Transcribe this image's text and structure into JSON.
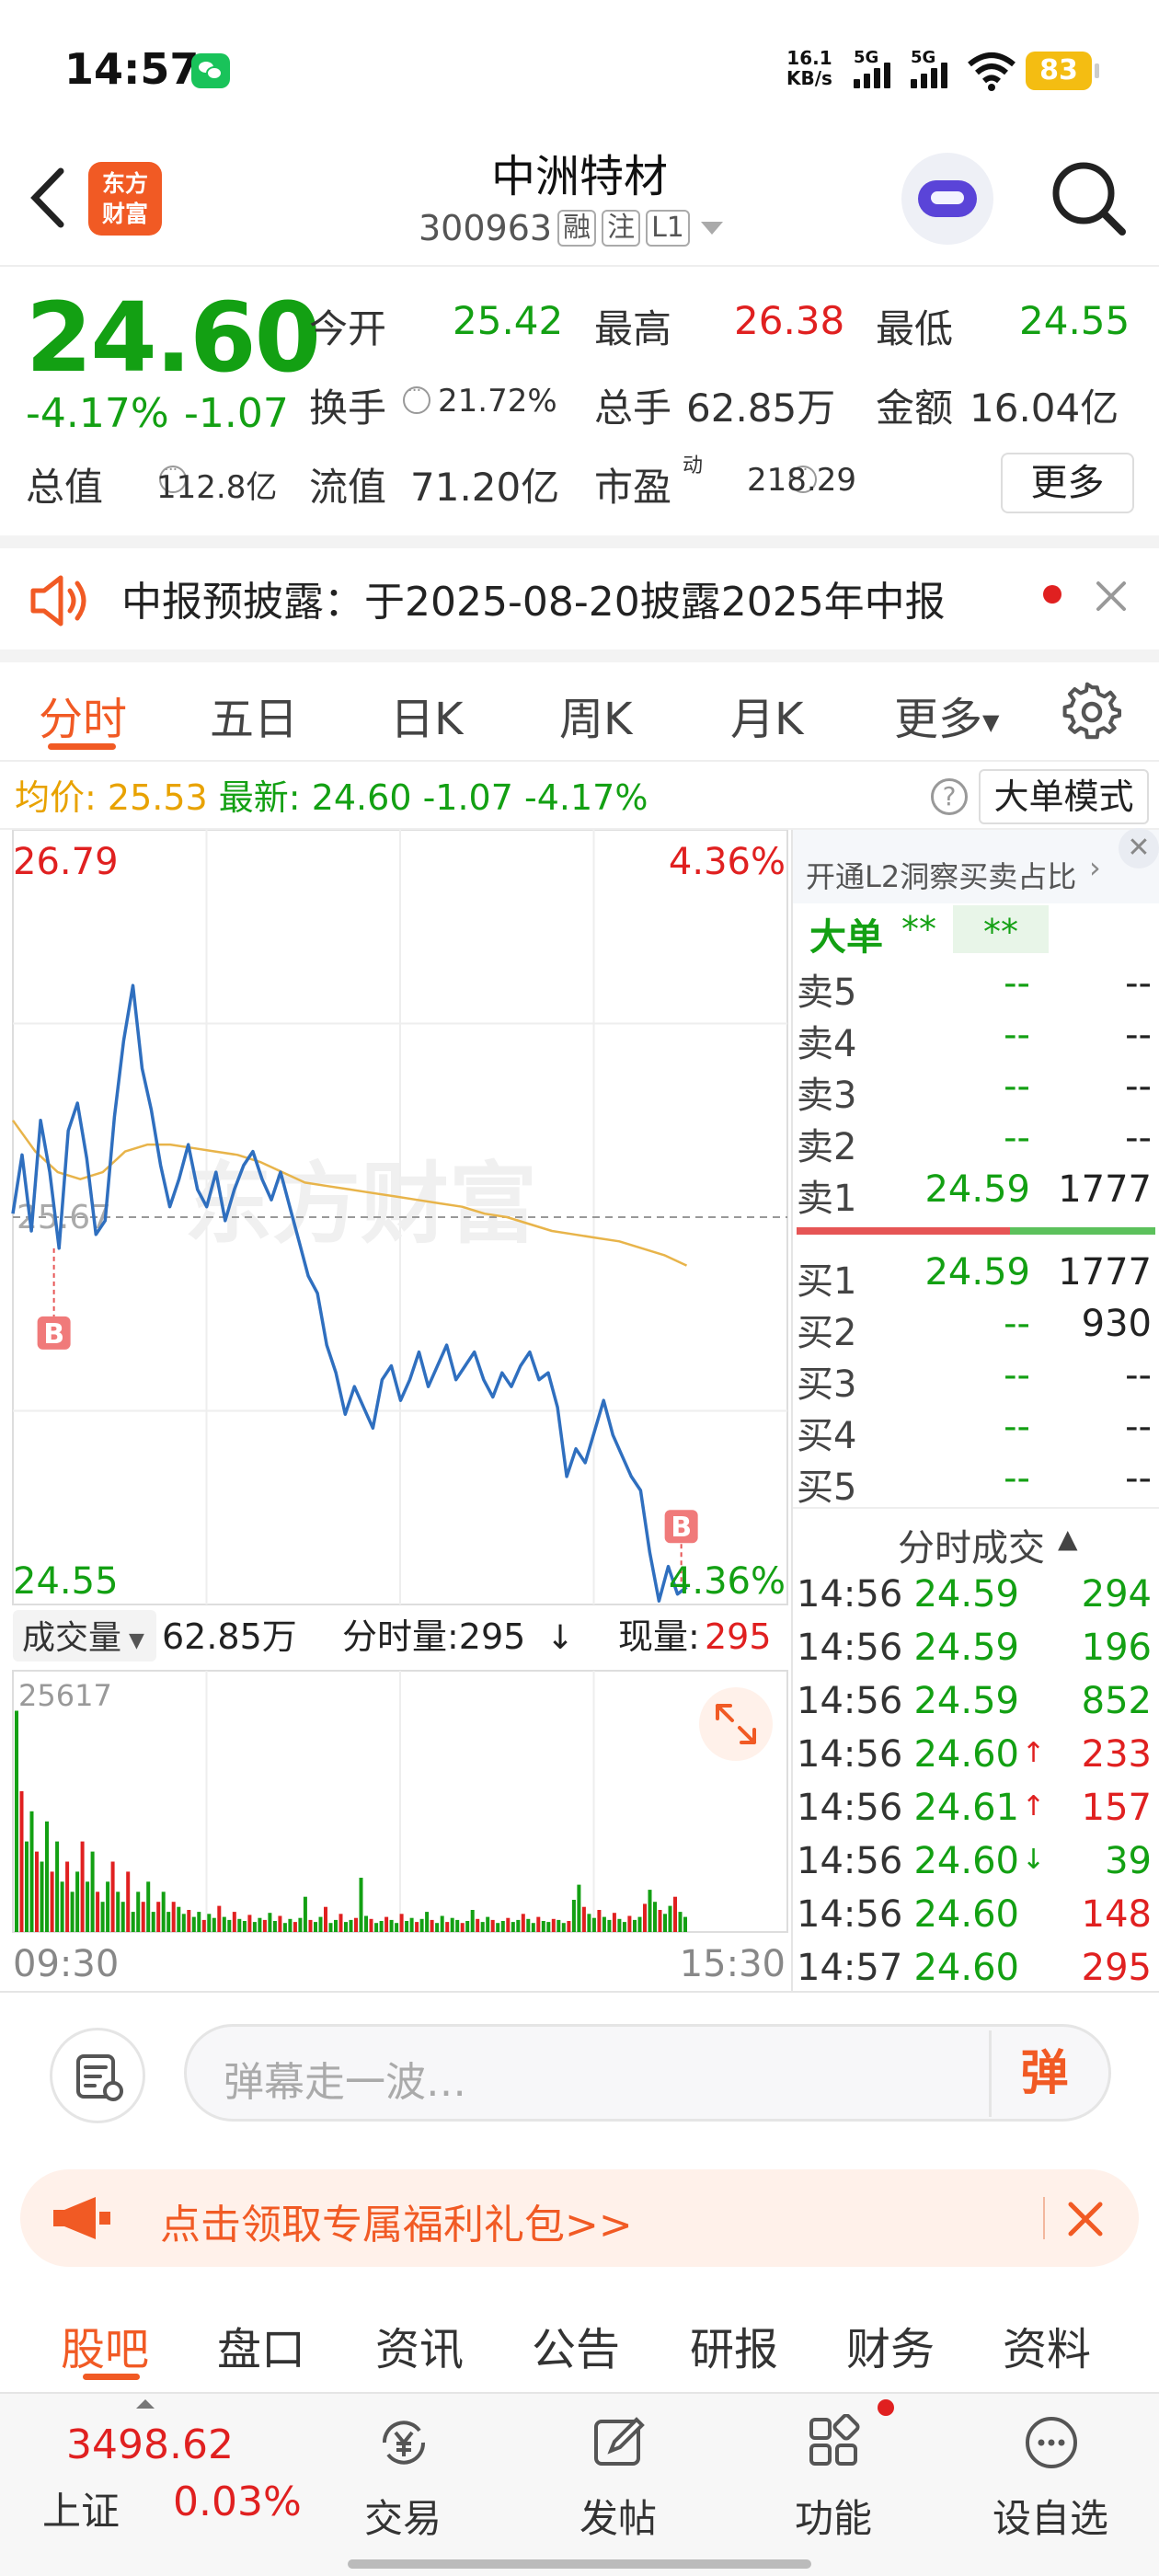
{
  "status_bar": {
    "time": "14:57",
    "net_speed_value": "16.1",
    "net_speed_unit": "KB/s",
    "signal1": "5G",
    "signal2": "5G",
    "battery": "83"
  },
  "header": {
    "logo_line1": "东方",
    "logo_line2": "财富",
    "stock_name": "中洲特材",
    "stock_code": "300963",
    "tags": [
      "融",
      "注",
      "L1"
    ]
  },
  "quote": {
    "price": "24.60",
    "change_pct": "-4.17%",
    "change": "-1.07",
    "open_label": "今开",
    "open": "25.42",
    "high_label": "最高",
    "high": "26.38",
    "low_label": "最低",
    "low": "24.55",
    "turnover_label": "换手",
    "turnover": "21.72%",
    "volume_label": "总手",
    "volume": "62.85万",
    "amount_label": "金额",
    "amount": "16.04亿",
    "mktcap_label": "总值",
    "mktcap": "112.8亿",
    "float_label": "流值",
    "float": "71.20亿",
    "pe_label": "市盈",
    "pe_sup": "动",
    "pe": "218.29",
    "more_button": "更多"
  },
  "notice": {
    "text": "中报预披露：于2025-08-20披露2025年中报"
  },
  "chart_tabs": {
    "items": [
      "分时",
      "五日",
      "日K",
      "周K",
      "月K",
      "更多"
    ],
    "active": "分时"
  },
  "info_line": {
    "avg_label": "均价:",
    "avg": "25.53",
    "latest_label": "最新:",
    "latest": "24.60",
    "change": "-1.07",
    "change_pct": "-4.17%",
    "help": "?",
    "mode_button": "大单模式"
  },
  "chart_data": {
    "type": "line",
    "title": "分时",
    "y_top": "26.79",
    "y_top_pct": "4.36%",
    "y_bottom": "24.55",
    "y_bottom_pct": "4.36%",
    "y_mid": "25.67",
    "watermark": "东方财富",
    "ylim": [
      24.55,
      26.79
    ],
    "marker_label": "B",
    "series": [
      {
        "values": [
          25.68,
          25.85,
          25.63,
          25.95,
          25.8,
          25.58,
          25.92,
          26.0,
          25.84,
          25.62,
          25.66,
          25.96,
          26.18,
          26.34,
          26.1,
          25.98,
          25.82,
          25.7,
          25.78,
          25.88,
          25.75,
          25.7,
          25.8,
          25.66,
          25.75,
          25.82,
          25.86,
          25.78,
          25.72,
          25.8,
          25.7,
          25.6,
          25.5,
          25.45,
          25.3,
          25.22,
          25.1,
          25.18,
          25.12,
          25.06,
          25.2,
          25.24,
          25.14,
          25.2,
          25.28,
          25.18,
          25.24,
          25.3,
          25.2,
          25.24,
          25.28,
          25.2,
          25.15,
          25.22,
          25.18,
          25.24,
          25.28,
          25.2,
          25.22,
          25.12,
          24.92,
          25.0,
          24.96,
          25.05,
          25.14,
          25.04,
          24.98,
          24.92,
          24.88,
          24.7,
          24.56,
          24.66,
          24.58,
          24.6
        ]
      },
      {
        "values": [
          25.95,
          25.86,
          25.8,
          25.78,
          25.8,
          25.86,
          25.88,
          25.88,
          25.87,
          25.86,
          25.85,
          25.83,
          25.8,
          25.77,
          25.76,
          25.75,
          25.74,
          25.73,
          25.72,
          25.71,
          25.7,
          25.68,
          25.67,
          25.65,
          25.63,
          25.62,
          25.61,
          25.6,
          25.58,
          25.56,
          25.53
        ]
      }
    ],
    "x_start": "09:30",
    "x_end": "15:30",
    "volume_label": "成交量",
    "volume_total": "62.85万",
    "minute_vol_label": "分时量:295",
    "current_vol_label": "现量:",
    "current_vol": "295",
    "volume_max": "25617",
    "volume_bars": [
      22000,
      14000,
      9000,
      12000,
      8000,
      7000,
      11000,
      6000,
      9000,
      5000,
      7000,
      4000,
      6000,
      9000,
      5000,
      8000,
      4000,
      3000,
      5000,
      7000,
      4000,
      3000,
      6000,
      2000,
      4000,
      3000,
      5000,
      2000,
      3000,
      4000,
      2000,
      3000,
      2500,
      1800,
      2200,
      1500,
      2000,
      1200,
      1800,
      1400,
      2600,
      1500,
      1200,
      2000,
      1300,
      1100,
      1700,
      1000,
      1400,
      1200,
      1900,
      1100,
      1600,
      900,
      1300,
      1000,
      1400,
      3500,
      1200,
      1000,
      1500,
      2500,
      900,
      1200,
      1800,
      1000,
      1200,
      1400,
      5400,
      1600,
      1300,
      900,
      1100,
      1500,
      1200,
      900,
      1800,
      1100,
      1400,
      1000,
      1300,
      2000,
      1200,
      900,
      1600,
      1000,
      1400,
      1200,
      900,
      1100,
      2200,
      1300,
      1000,
      1500,
      1200,
      900,
      1100,
      1400,
      1000,
      1200,
      1800,
      1300,
      900,
      1500,
      1100,
      1000,
      1300,
      1200,
      900,
      1100,
      3200,
      4700,
      2500,
      1800,
      1400,
      2200,
      1500,
      1200,
      1900,
      1300,
      1000,
      1600,
      1200,
      1500,
      2800,
      4200,
      3000,
      2200,
      1800,
      2600,
      3500,
      2000,
      1500
    ]
  },
  "right_panel": {
    "promo": "开通L2洞察买卖占比",
    "big_order_label": "大单",
    "big_order_v1": "**",
    "big_order_v2": "**",
    "asks": [
      {
        "label": "卖5",
        "price": "--",
        "vol": "--"
      },
      {
        "label": "卖4",
        "price": "--",
        "vol": "--"
      },
      {
        "label": "卖3",
        "price": "--",
        "vol": "--"
      },
      {
        "label": "卖2",
        "price": "--",
        "vol": "--"
      },
      {
        "label": "卖1",
        "price": "24.59",
        "vol": "1777"
      }
    ],
    "bids": [
      {
        "label": "买1",
        "price": "24.59",
        "vol": "1777"
      },
      {
        "label": "买2",
        "price": "--",
        "vol": "930"
      },
      {
        "label": "买3",
        "price": "--",
        "vol": "--"
      },
      {
        "label": "买4",
        "price": "--",
        "vol": "--"
      },
      {
        "label": "买5",
        "price": "--",
        "vol": "--"
      }
    ],
    "ticks_title": "分时成交",
    "ticks": [
      {
        "time": "14:56",
        "price": "24.59",
        "vol": "294",
        "arrow": "",
        "color": "green"
      },
      {
        "time": "14:56",
        "price": "24.59",
        "vol": "196",
        "arrow": "",
        "color": "green"
      },
      {
        "time": "14:56",
        "price": "24.59",
        "vol": "852",
        "arrow": "",
        "color": "green"
      },
      {
        "time": "14:56",
        "price": "24.60",
        "vol": "233",
        "arrow": "↑",
        "color": "red"
      },
      {
        "time": "14:56",
        "price": "24.61",
        "vol": "157",
        "arrow": "↑",
        "color": "red"
      },
      {
        "time": "14:56",
        "price": "24.60",
        "vol": "39",
        "arrow": "↓",
        "color": "green"
      },
      {
        "time": "14:56",
        "price": "24.60",
        "vol": "148",
        "arrow": "",
        "color": "red"
      },
      {
        "time": "14:57",
        "price": "24.60",
        "vol": "295",
        "arrow": "",
        "color": "red"
      }
    ]
  },
  "comment": {
    "placeholder": "弹幕走一波…",
    "danmu_button": "弹"
  },
  "promo": {
    "text": "点击领取专属福利礼包>>"
  },
  "content_tabs": {
    "items": [
      "股吧",
      "盘口",
      "资讯",
      "公告",
      "研报",
      "财务",
      "资料"
    ],
    "active": "股吧"
  },
  "bottom_nav": {
    "index_value": "3498.62",
    "index_name": "上证",
    "index_change": "0.03%",
    "items": [
      "交易",
      "发帖",
      "功能",
      "设自选"
    ]
  },
  "colors": {
    "up": "#e02020",
    "down": "#13a013",
    "accent": "#f15a24",
    "price_line": "#2f6fbf",
    "avg_line": "#e8b44a"
  }
}
